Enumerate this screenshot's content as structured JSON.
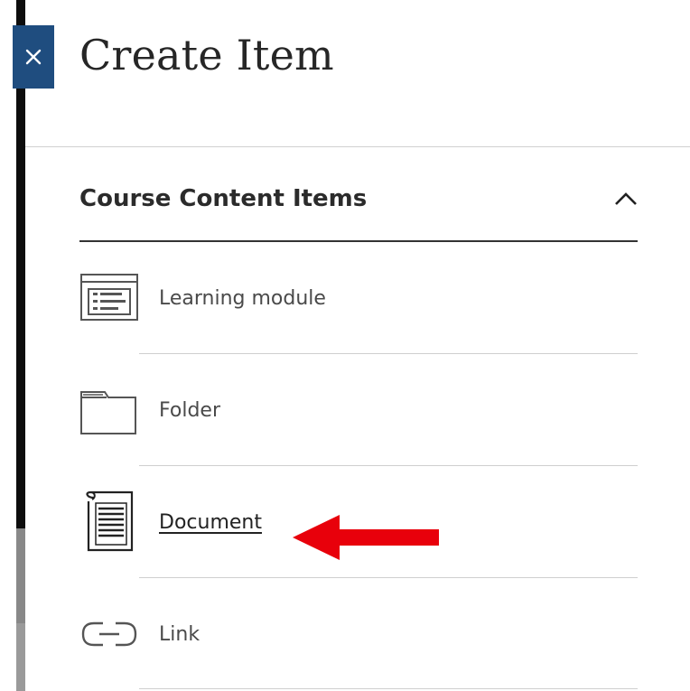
{
  "panel": {
    "title": "Create Item",
    "close_glyph": "×"
  },
  "section": {
    "title": "Course Content Items",
    "expanded": true
  },
  "items": [
    {
      "label": "Learning module",
      "icon": "learning-module-icon"
    },
    {
      "label": "Folder",
      "icon": "folder-icon"
    },
    {
      "label": "Document",
      "icon": "document-icon",
      "highlighted": true
    },
    {
      "label": "Link",
      "icon": "link-icon"
    }
  ],
  "colors": {
    "close_button_bg": "#1f4d7f",
    "annotation_arrow": "#e8000b"
  }
}
